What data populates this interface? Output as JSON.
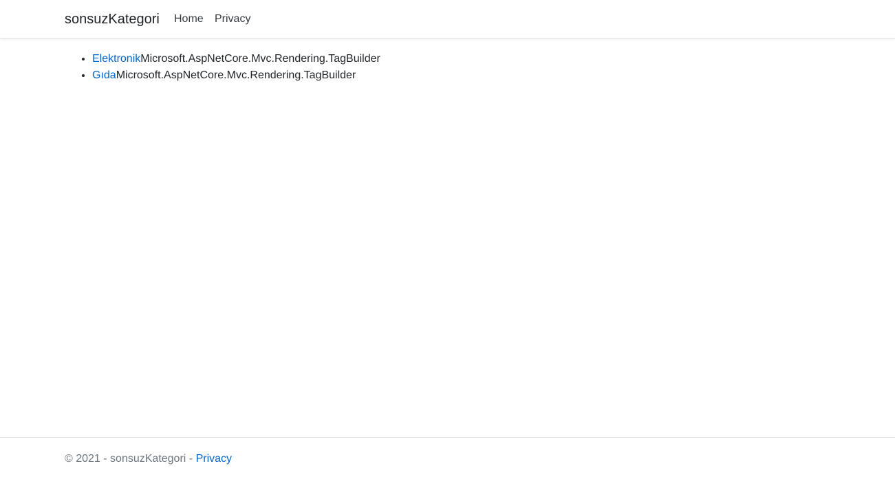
{
  "navbar": {
    "brand": "sonsuzKategori",
    "links": [
      {
        "label": "Home"
      },
      {
        "label": "Privacy"
      }
    ]
  },
  "main": {
    "categories": [
      {
        "name": "Elektronik",
        "suffix": "Microsoft.AspNetCore.Mvc.Rendering.TagBuilder"
      },
      {
        "name": "Gıda",
        "suffix": "Microsoft.AspNetCore.Mvc.Rendering.TagBuilder"
      }
    ]
  },
  "footer": {
    "copyright": "© 2021 - sonsuzKategori - ",
    "privacy_label": "Privacy"
  },
  "colors": {
    "link": "#0366d6",
    "text": "#212529",
    "muted": "#6c757d",
    "border": "#dee2e6"
  }
}
